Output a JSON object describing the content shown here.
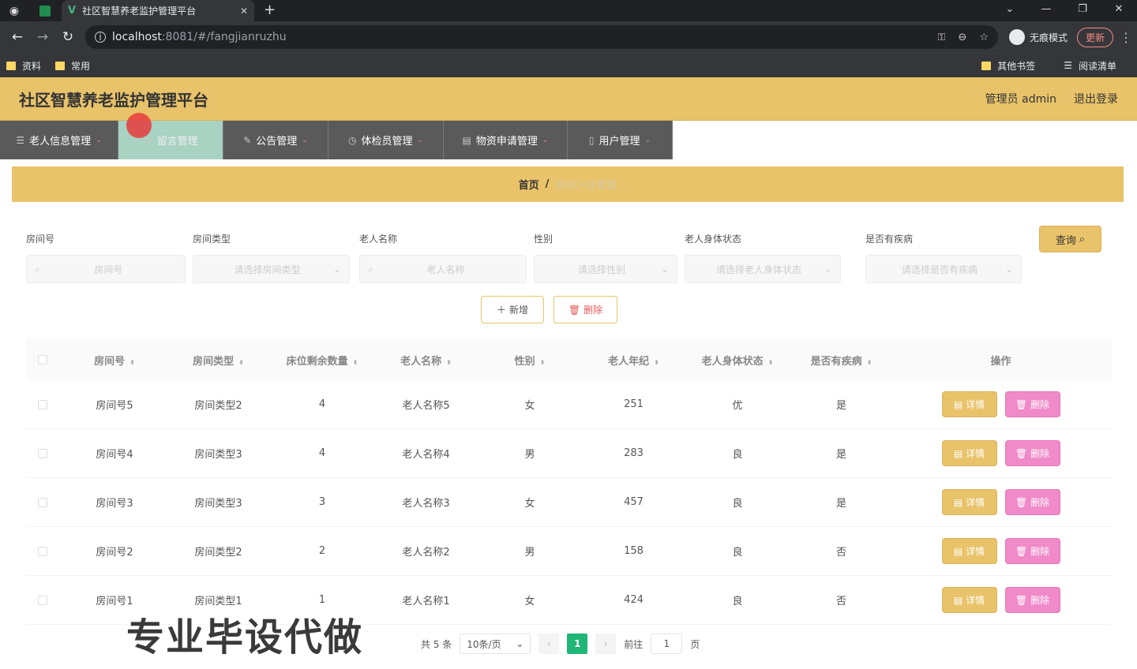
{
  "browser": {
    "tab_title": "社区智慧养老监护管理平台",
    "url_host": "localhost",
    "url_path": ":8081/#/fangjianruzhu",
    "incognito_label": "无痕模式",
    "update_label": "更新",
    "bookmarks": [
      "资料",
      "常用"
    ],
    "bookmarks_right": [
      "其他书签",
      "阅读清单"
    ]
  },
  "header": {
    "title": "社区智慧养老监护管理平台",
    "admin": "管理员 admin",
    "logout": "退出登录"
  },
  "menu": [
    {
      "label": "老人信息管理",
      "icon": "list-icon"
    },
    {
      "label": "留言管理",
      "icon": "chat-icon",
      "active": true
    },
    {
      "label": "公告管理",
      "icon": "announce-icon"
    },
    {
      "label": "体检员管理",
      "icon": "clock-icon"
    },
    {
      "label": "物资申请管理",
      "icon": "box-icon"
    },
    {
      "label": "用户管理",
      "icon": "user-icon"
    }
  ],
  "breadcrumb": {
    "home": "首页",
    "sep": "/",
    "current": "房间入住管理"
  },
  "search": {
    "fields": [
      {
        "label": "房间号",
        "placeholder": "房间号"
      },
      {
        "label": "房间类型",
        "placeholder": "请选择房间类型"
      },
      {
        "label": "老人名称",
        "placeholder": "老人名称"
      },
      {
        "label": "性别",
        "placeholder": "请选择性别"
      },
      {
        "label": "老人身体状态",
        "placeholder": "请选择老人身体状态"
      },
      {
        "label": "是否有疾病",
        "placeholder": "请选择是否有疾病"
      }
    ],
    "query_label": "查询"
  },
  "actions": {
    "add": "新增",
    "delete": "删除"
  },
  "table": {
    "headers": [
      "房间号",
      "房间类型",
      "床位剩余数量",
      "老人名称",
      "性别",
      "老人年纪",
      "老人身体状态",
      "是否有疾病",
      "操作"
    ],
    "rows": [
      [
        "房间号5",
        "房间类型2",
        "4",
        "老人名称5",
        "女",
        "251",
        "优",
        "是"
      ],
      [
        "房间号4",
        "房间类型3",
        "4",
        "老人名称4",
        "男",
        "283",
        "良",
        "是"
      ],
      [
        "房间号3",
        "房间类型3",
        "3",
        "老人名称3",
        "女",
        "457",
        "良",
        "是"
      ],
      [
        "房间号2",
        "房间类型2",
        "2",
        "老人名称2",
        "男",
        "158",
        "良",
        "否"
      ],
      [
        "房间号1",
        "房间类型1",
        "1",
        "老人名称1",
        "女",
        "424",
        "良",
        "否"
      ]
    ],
    "detail_label": "详情",
    "row_delete_label": "删除"
  },
  "pager": {
    "total": "共 5 条",
    "page_size": "10条/页",
    "current": "1",
    "goto_prefix": "前往",
    "goto_value": "1",
    "goto_suffix": "页"
  },
  "watermark": "专业毕设代做",
  "colors": {
    "accent": "#e8c36a",
    "menu_bg": "#5a5a5a",
    "pink": "#f08ac8",
    "green": "#1fb676"
  }
}
